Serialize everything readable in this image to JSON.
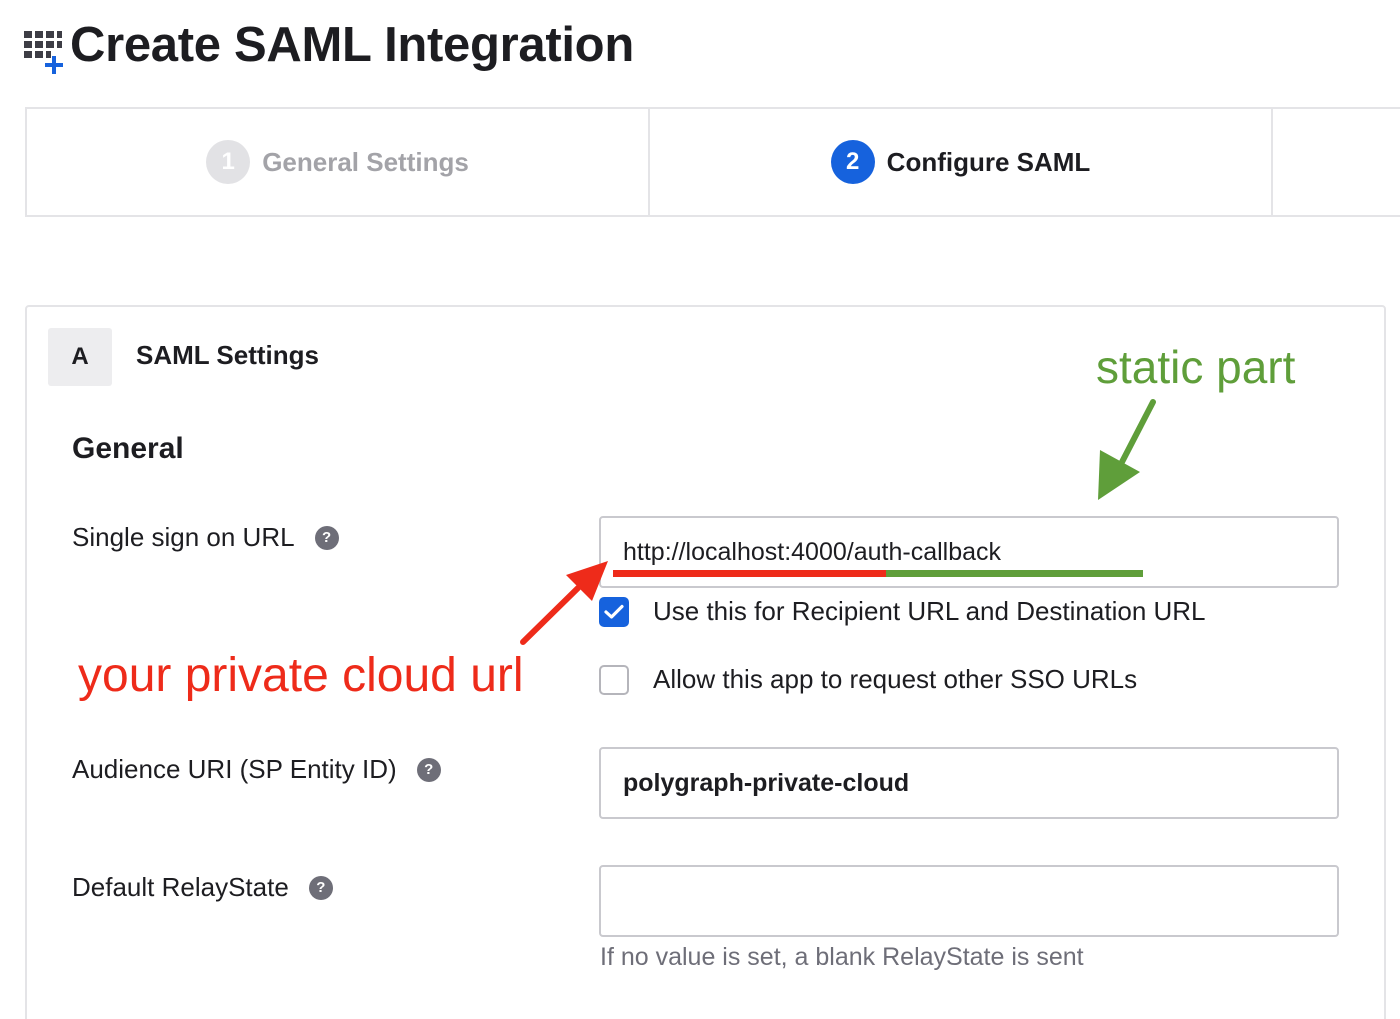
{
  "header": {
    "title": "Create SAML Integration",
    "icon": "grid-plus-icon"
  },
  "stepper": {
    "steps": [
      {
        "number": "1",
        "label": "General Settings",
        "state": "inactive"
      },
      {
        "number": "2",
        "label": "Configure SAML",
        "state": "active"
      }
    ]
  },
  "section": {
    "badge": "A",
    "title": "SAML Settings",
    "group_title": "General"
  },
  "fields": {
    "sso_url": {
      "label": "Single sign on URL",
      "value": "http://localhost:4000/auth-callback"
    },
    "recipient_checkbox": {
      "label": "Use this for Recipient URL and Destination URL",
      "checked": true
    },
    "other_sso_checkbox": {
      "label": "Allow this app to request other SSO URLs",
      "checked": false
    },
    "audience_uri": {
      "label": "Audience URI (SP Entity ID)",
      "value": "polygraph-private-cloud"
    },
    "relay_state": {
      "label": "Default RelayState",
      "value": "",
      "hint": "If no value is set, a blank RelayState is sent"
    }
  },
  "annotations": {
    "static_part": "static part",
    "private_cloud": "your private cloud url"
  },
  "colors": {
    "primary": "#1662dd",
    "annotation_red": "#ee2b1a",
    "annotation_green": "#5f9e3a"
  }
}
